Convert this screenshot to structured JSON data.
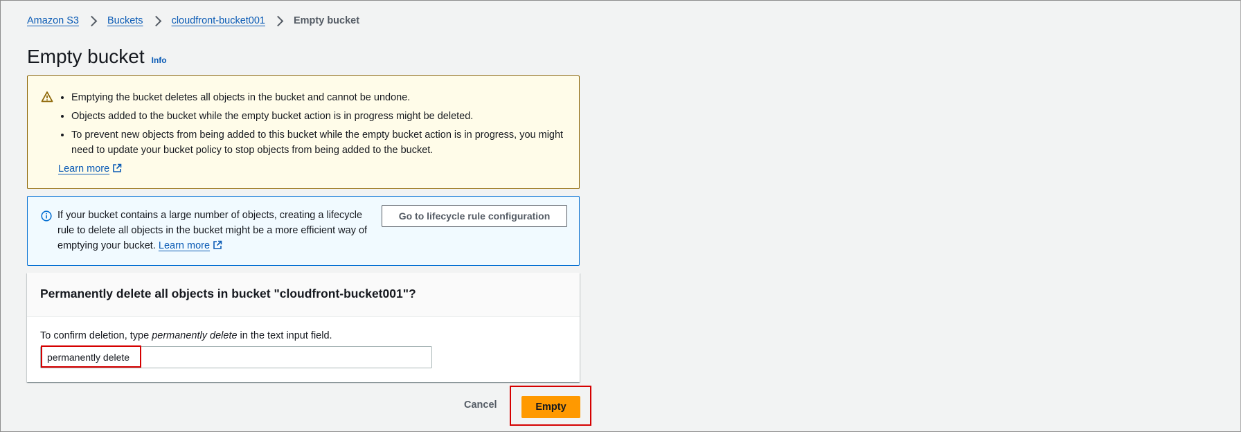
{
  "breadcrumb": {
    "items": [
      "Amazon S3",
      "Buckets",
      "cloudfront-bucket001"
    ],
    "current": "Empty bucket"
  },
  "header": {
    "title": "Empty bucket",
    "info_label": "Info"
  },
  "warning_alert": {
    "icon": "warning-icon",
    "bullets": [
      "Emptying the bucket deletes all objects in the bucket and cannot be undone.",
      "Objects added to the bucket while the empty bucket action is in progress might be deleted.",
      "To prevent new objects from being added to this bucket while the empty bucket action is in progress, you might need to update your bucket policy to stop objects from being added to the bucket."
    ],
    "learn_more": "Learn more"
  },
  "info_alert": {
    "icon": "info-icon",
    "text": "If your bucket contains a large number of objects, creating a lifecycle rule to delete all objects in the bucket might be a more efficient way of emptying your bucket.",
    "learn_more": "Learn more",
    "button_label": "Go to lifecycle rule configuration"
  },
  "confirm": {
    "title": "Permanently delete all objects in bucket \"cloudfront-bucket001\"?",
    "label_prefix": "To confirm deletion, type ",
    "label_emphasis": "permanently delete",
    "label_suffix": " in the text input field.",
    "input_value": "permanently delete"
  },
  "footer": {
    "cancel_label": "Cancel",
    "empty_label": "Empty"
  },
  "colors": {
    "link": "#0b5bb5",
    "primary_button": "#ff9900",
    "warning_bg": "#fffce9",
    "info_bg": "#f1faff",
    "highlight": "#d50000"
  }
}
